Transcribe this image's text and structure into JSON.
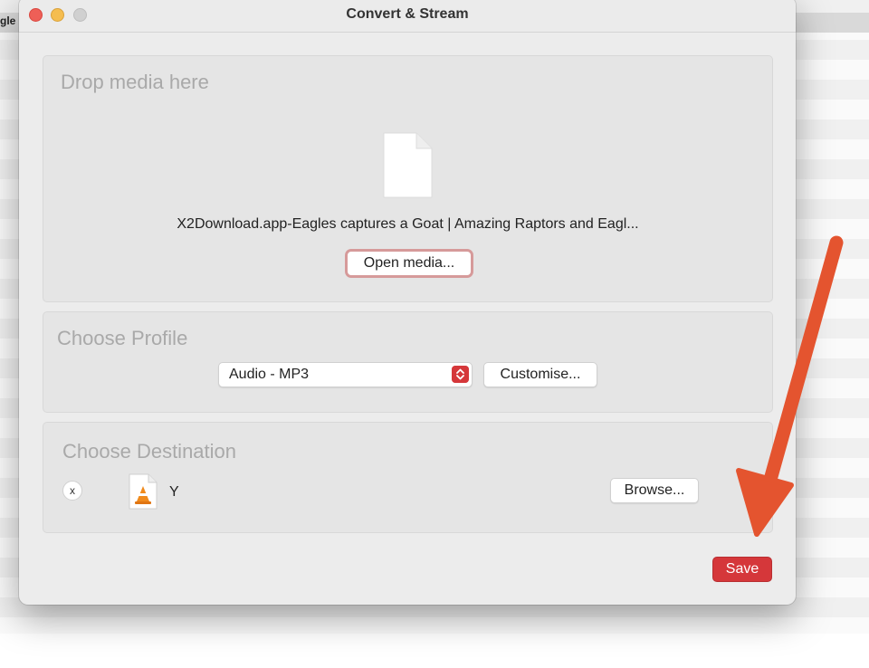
{
  "background": {
    "partial_label": "gle"
  },
  "window": {
    "title": "Convert & Stream"
  },
  "drop_panel": {
    "title": "Drop media here",
    "icon": "document-icon",
    "file_name": "X2Download.app-Eagles captures a Goat | Amazing Raptors and Eagl...",
    "open_button_label": "Open media..."
  },
  "profile_panel": {
    "title": "Choose Profile",
    "selected_profile": "Audio - MP3",
    "customise_label": "Customise..."
  },
  "destination_panel": {
    "title": "Choose Destination",
    "remove_label": "x",
    "file_icon": "vlc-file-icon",
    "file_name": "Y",
    "browse_label": "Browse..."
  },
  "footer": {
    "save_label": "Save"
  },
  "colors": {
    "accent": "#d5373a",
    "arrow": "#e4542f"
  }
}
